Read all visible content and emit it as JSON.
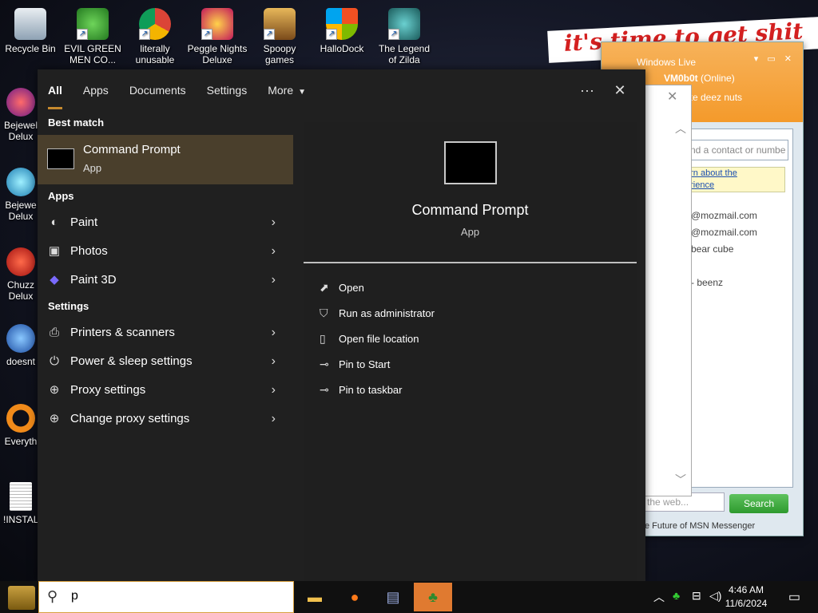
{
  "desktop": {
    "icons": [
      {
        "label": "Recycle Bin",
        "icon": "recycle-bin-icon"
      },
      {
        "label": "EVIL GREEN MEN CO...",
        "icon": "msn-people-icon"
      },
      {
        "label": "literally unusable",
        "icon": "chrome-icon"
      },
      {
        "label": "Peggle Nights Deluxe",
        "icon": "peggle-icon"
      },
      {
        "label": "Spoopy games",
        "icon": "folder-icon"
      },
      {
        "label": "HalloDock",
        "icon": "windows-shield-icon"
      },
      {
        "label": "The Legend of Zilda",
        "icon": "zilda-icon"
      }
    ],
    "left_icons": [
      {
        "label": "Bejewel Delux",
        "icon": "bejeweled-icon"
      },
      {
        "label": "Bejewe Delux",
        "icon": "diamond-icon"
      },
      {
        "label": "Chuzz Delux",
        "icon": "chuzzle-icon"
      },
      {
        "label": "doesnt",
        "icon": "globe-icon"
      },
      {
        "label": "Everyth",
        "icon": "magnifier-icon"
      },
      {
        "label": "!INSTALL",
        "icon": "document-icon"
      }
    ],
    "banner": "it's time to get shit"
  },
  "msn": {
    "title": "Windows Live",
    "user": "VM0b0t",
    "status": "(Online)",
    "personal_msg": "rate deez nuts",
    "search_placeholder": "nd a contact or numbe",
    "link_line1": "arn about the",
    "link_line2": "erience",
    "contacts": [
      "@mozmail.com",
      "@mozmail.com",
      "bear cube",
      "- beenz"
    ],
    "web_placeholder": "the web...",
    "search_button": "Search",
    "footer": "e Future of MSN Messenger"
  },
  "search": {
    "filters": [
      {
        "label": "All",
        "active": true
      },
      {
        "label": "Apps",
        "active": false
      },
      {
        "label": "Documents",
        "active": false
      },
      {
        "label": "Settings",
        "active": false
      },
      {
        "label": "More",
        "active": false
      }
    ],
    "more_icon": "···",
    "close_icon": "✕",
    "best_match_header": "Best match",
    "best_match": {
      "title": "Command Prompt",
      "subtitle": "App"
    },
    "apps_header": "Apps",
    "apps": [
      {
        "label": "Paint",
        "icon": "paint-icon"
      },
      {
        "label": "Photos",
        "icon": "photos-icon"
      },
      {
        "label": "Paint 3D",
        "icon": "paint3d-icon"
      }
    ],
    "settings_header": "Settings",
    "settings": [
      {
        "label": "Printers & scanners",
        "icon": "printer-icon"
      },
      {
        "label": "Power & sleep settings",
        "icon": "power-icon"
      },
      {
        "label": "Proxy settings",
        "icon": "globe-icon"
      },
      {
        "label": "Change proxy settings",
        "icon": "globe-icon"
      }
    ],
    "preview": {
      "title": "Command Prompt",
      "subtitle": "App",
      "actions": [
        {
          "label": "Open",
          "icon": "open-icon"
        },
        {
          "label": "Run as administrator",
          "icon": "shield-icon"
        },
        {
          "label": "Open file location",
          "icon": "folder-location-icon"
        },
        {
          "label": "Pin to Start",
          "icon": "pin-icon"
        },
        {
          "label": "Pin to taskbar",
          "icon": "pin-icon"
        }
      ]
    }
  },
  "taskbar": {
    "search_text": "p",
    "apps": [
      "file-explorer-icon",
      "firefox-icon",
      "notepad-icon",
      "msn-messenger-icon"
    ],
    "time": "4:46 AM",
    "date": "11/6/2024"
  }
}
